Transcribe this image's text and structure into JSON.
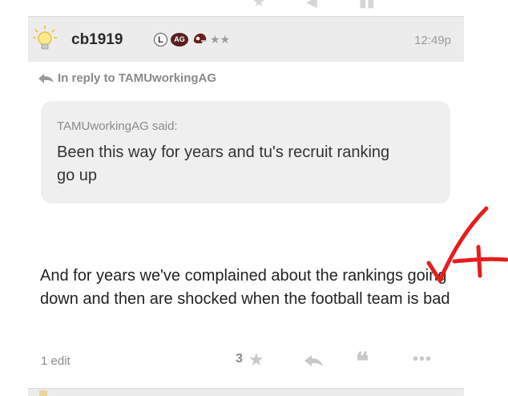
{
  "post": {
    "username": "cb1919",
    "badge_l": "L",
    "badge_ag": "AG",
    "rank_stars": "★★",
    "time": "12:49p",
    "reply_to": "In reply to TAMUworkingAG",
    "quote": {
      "author": "TAMUworkingAG said:",
      "text": "Been this way for years and tu's recruit ranking go up"
    },
    "body": "And for years we've complained about the rankings going down and then are shocked when the football team is bad",
    "footer": {
      "edit_count": "1 edit",
      "likes": "3",
      "like_icon": "★",
      "quote_icon": "❝",
      "more_icon": "•••"
    }
  },
  "icons": {
    "avatar": "lightbulb-icon",
    "reply": "reply-arrow-icon",
    "annotation": "red-checkmark-plus"
  },
  "colors": {
    "header_bg": "#ececec",
    "quote_bg": "#efefef",
    "badge_ag": "#5a1f1f",
    "annotation": "#e41e1e",
    "muted": "#8a8a8a"
  }
}
